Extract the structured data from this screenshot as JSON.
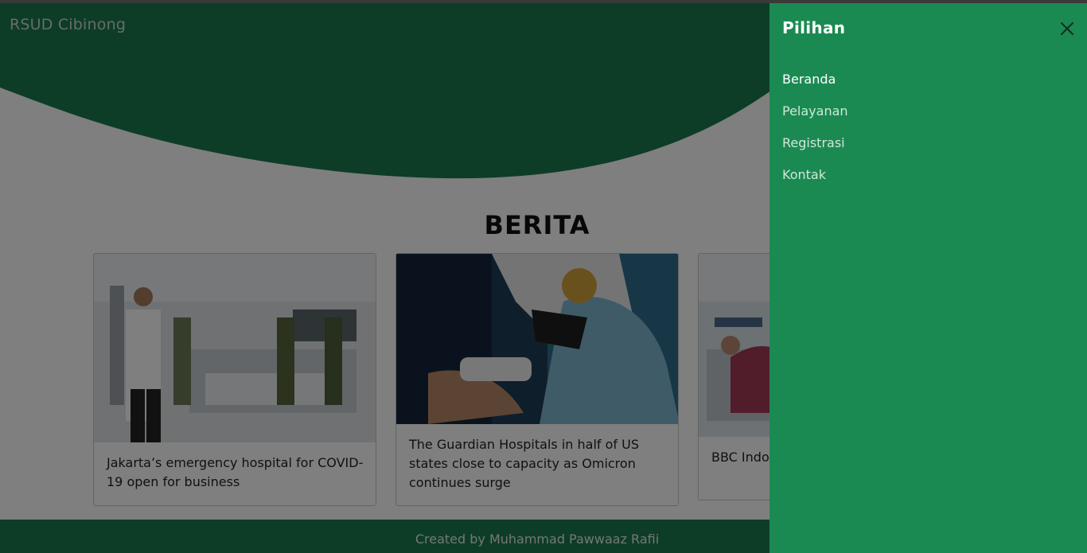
{
  "header": {
    "brand": "RSUD Cibinong"
  },
  "news": {
    "title": "BERITA",
    "cards": [
      {
        "caption": "Jakarta’s emergency hospital for COVID-19 open for business"
      },
      {
        "caption": "The Guardian Hospitals in half of US states close to capacity as Omicron continues surge"
      },
      {
        "caption": "BBC Indonesia ... worsening ..."
      }
    ]
  },
  "footer": {
    "text": "Created by Muhammad Pawwaaz Rafii"
  },
  "offcanvas": {
    "title": "Pilihan",
    "close_icon": "close-icon",
    "items": [
      {
        "label": "Beranda",
        "active": true
      },
      {
        "label": "Pelayanan",
        "active": false
      },
      {
        "label": "Registrasi",
        "active": false
      },
      {
        "label": "Kontak",
        "active": false
      }
    ]
  },
  "colors": {
    "primary_green": "#1a7a4c",
    "offcanvas_green": "#1b8a52",
    "overlay": "rgba(0,0,0,0.5)"
  }
}
